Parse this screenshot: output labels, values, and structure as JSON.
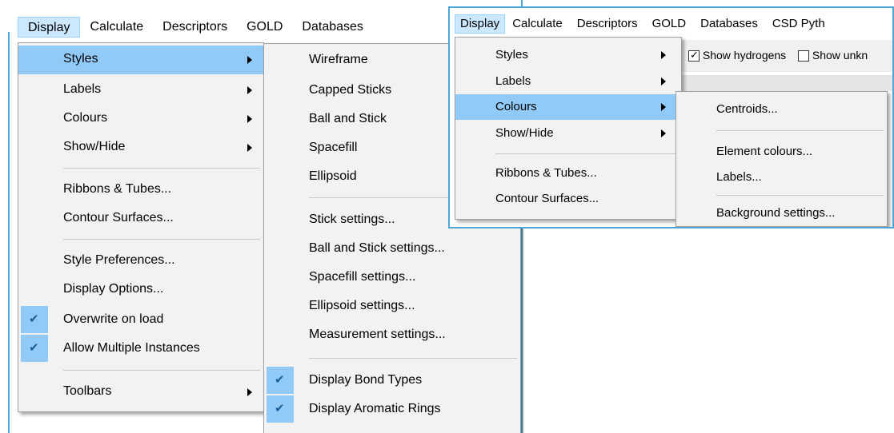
{
  "left": {
    "menubar": [
      "Display",
      "Calculate",
      "Descriptors",
      "GOLD",
      "Databases"
    ],
    "display_menu": {
      "items": [
        {
          "label": "Styles",
          "submenu": true,
          "highlight": true
        },
        {
          "label": "Labels",
          "submenu": true
        },
        {
          "label": "Colours",
          "submenu": true
        },
        {
          "label": "Show/Hide",
          "submenu": true
        },
        {
          "label": "Ribbons & Tubes..."
        },
        {
          "label": "Contour Surfaces..."
        },
        {
          "label": "Style Preferences..."
        },
        {
          "label": "Display Options..."
        },
        {
          "label": "Overwrite on load",
          "checked": true
        },
        {
          "label": "Allow Multiple Instances",
          "checked": true
        },
        {
          "label": "Toolbars",
          "submenu": true
        }
      ]
    },
    "styles_submenu": {
      "items": [
        {
          "label": "Wireframe"
        },
        {
          "label": "Capped Sticks"
        },
        {
          "label": "Ball and Stick"
        },
        {
          "label": "Spacefill"
        },
        {
          "label": "Ellipsoid"
        },
        {
          "label": "Stick settings..."
        },
        {
          "label": "Ball and Stick settings..."
        },
        {
          "label": "Spacefill settings..."
        },
        {
          "label": "Ellipsoid settings..."
        },
        {
          "label": "Measurement settings..."
        },
        {
          "label": "Display Bond Types",
          "checked": true
        },
        {
          "label": "Display Aromatic Rings",
          "checked": true
        }
      ]
    }
  },
  "right": {
    "menubar": [
      "Display",
      "Calculate",
      "Descriptors",
      "GOLD",
      "Databases",
      "CSD Pyth"
    ],
    "toolbar": {
      "show_hydrogens": "Show hydrogens",
      "show_unknown": "Show unkn"
    },
    "display_menu": {
      "items": [
        {
          "label": "Styles",
          "submenu": true
        },
        {
          "label": "Labels",
          "submenu": true
        },
        {
          "label": "Colours",
          "submenu": true,
          "highlight": true
        },
        {
          "label": "Show/Hide",
          "submenu": true
        },
        {
          "label": "Ribbons & Tubes..."
        },
        {
          "label": "Contour Surfaces..."
        }
      ]
    },
    "colours_submenu": {
      "items": [
        {
          "label": "Centroids..."
        },
        {
          "label": "Element colours..."
        },
        {
          "label": "Labels..."
        },
        {
          "label": "Background settings..."
        }
      ]
    }
  },
  "colors": {
    "highlight": "#91c9f7",
    "menubar_active": "#cce8ff",
    "menu_bg": "#f2f2f2",
    "window_border": "#4aa8d8"
  }
}
